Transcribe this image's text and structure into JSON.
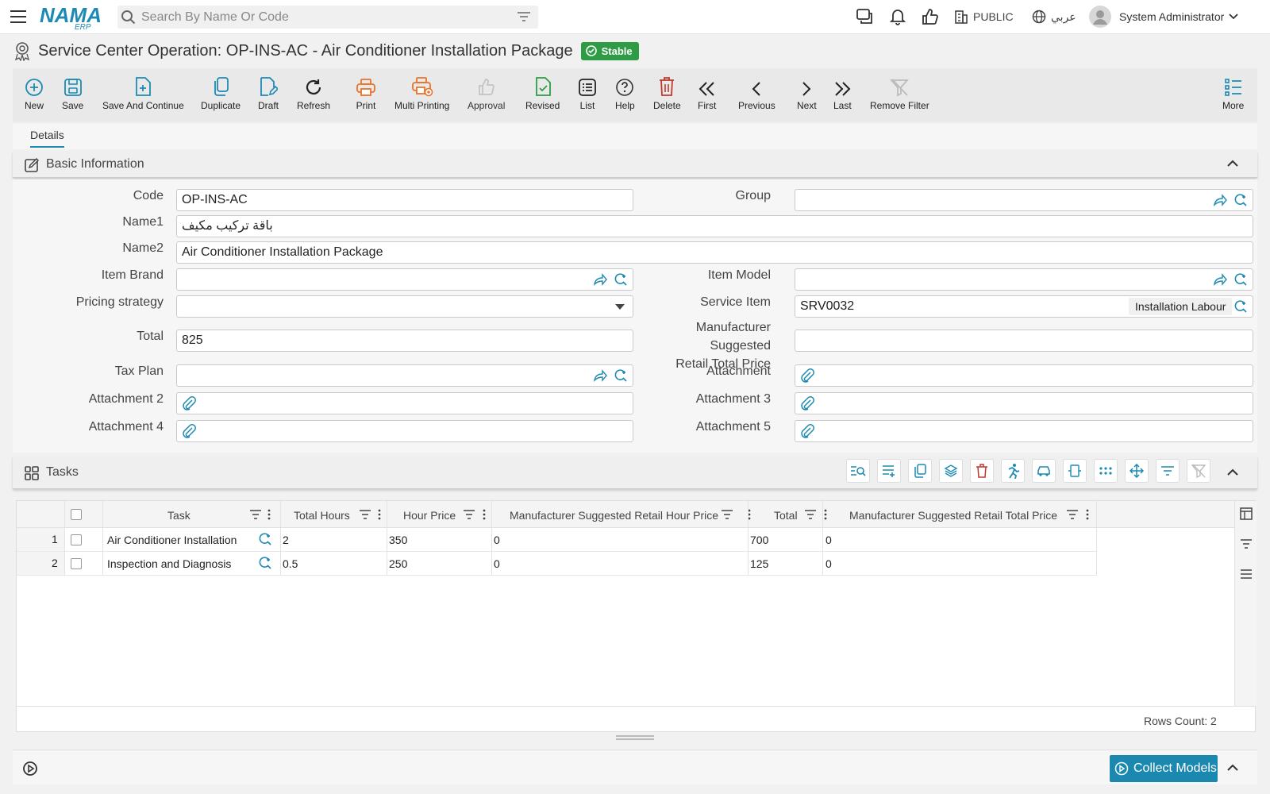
{
  "header": {
    "search_placeholder": "Search By Name Or Code",
    "public_label": "PUBLIC",
    "language_label": "عربي",
    "user_name": "System Administrator"
  },
  "page": {
    "title": "Service Center Operation: OP-INS-AC - Air Conditioner Installation Package",
    "status": "Stable"
  },
  "toolbar": {
    "new": "New",
    "save": "Save",
    "save_continue": "Save And Continue",
    "duplicate": "Duplicate",
    "draft": "Draft",
    "refresh": "Refresh",
    "print": "Print",
    "multi_printing": "Multi Printing",
    "approval": "Approval",
    "revised": "Revised",
    "list": "List",
    "help": "Help",
    "delete": "Delete",
    "first": "First",
    "previous": "Previous",
    "next": "Next",
    "last": "Last",
    "remove_filter": "Remove Filter",
    "more": "More"
  },
  "tabs": {
    "details": "Details"
  },
  "basic": {
    "title": "Basic Information",
    "code_label": "Code",
    "code": "OP-INS-AC",
    "group_label": "Group",
    "group": "",
    "name1_label": "Name1",
    "name1": "باقة تركيب مكيف",
    "name2_label": "Name2",
    "name2": "Air Conditioner Installation Package",
    "brand_label": "Item Brand",
    "brand": "",
    "model_label": "Item Model",
    "model": "",
    "pricing_label": "Pricing strategy",
    "pricing": "",
    "service_item_label": "Service Item",
    "service_item": "SRV0032",
    "service_item_name": "Installation Labour",
    "total_label": "Total",
    "total": "825",
    "msrp_label_1": "Manufacturer Suggested",
    "msrp_label_2": "Retail Total Price",
    "msrp": "",
    "tax_label": "Tax Plan",
    "tax": "",
    "attachment_label": "Attachment",
    "attachment2_label": "Attachment 2",
    "attachment3_label": "Attachment 3",
    "attachment4_label": "Attachment 4",
    "attachment5_label": "Attachment 5"
  },
  "tasks": {
    "title": "Tasks",
    "columns": [
      "Task",
      "Total Hours",
      "Hour Price",
      "Manufacturer Suggested Retail Hour Price",
      "Total",
      "Manufacturer Suggested Retail Total Price"
    ],
    "rows": [
      {
        "num": "1",
        "task": "Air Conditioner Installation",
        "hours": "2",
        "hour_price": "350",
        "msr_hour": "0",
        "total": "700",
        "msr_total": "0"
      },
      {
        "num": "2",
        "task": "Inspection and Diagnosis",
        "hours": "0.5",
        "hour_price": "250",
        "msr_hour": "0",
        "total": "125",
        "msr_total": "0"
      }
    ],
    "rows_count": "Rows Count: 2"
  },
  "footer": {
    "collect_models": "Collect Models"
  },
  "colors": {
    "accent": "#1b88b0",
    "stable": "#2e9c45",
    "delete": "#c0392b",
    "print": "#e8732a",
    "save": "#1d8ab3"
  }
}
